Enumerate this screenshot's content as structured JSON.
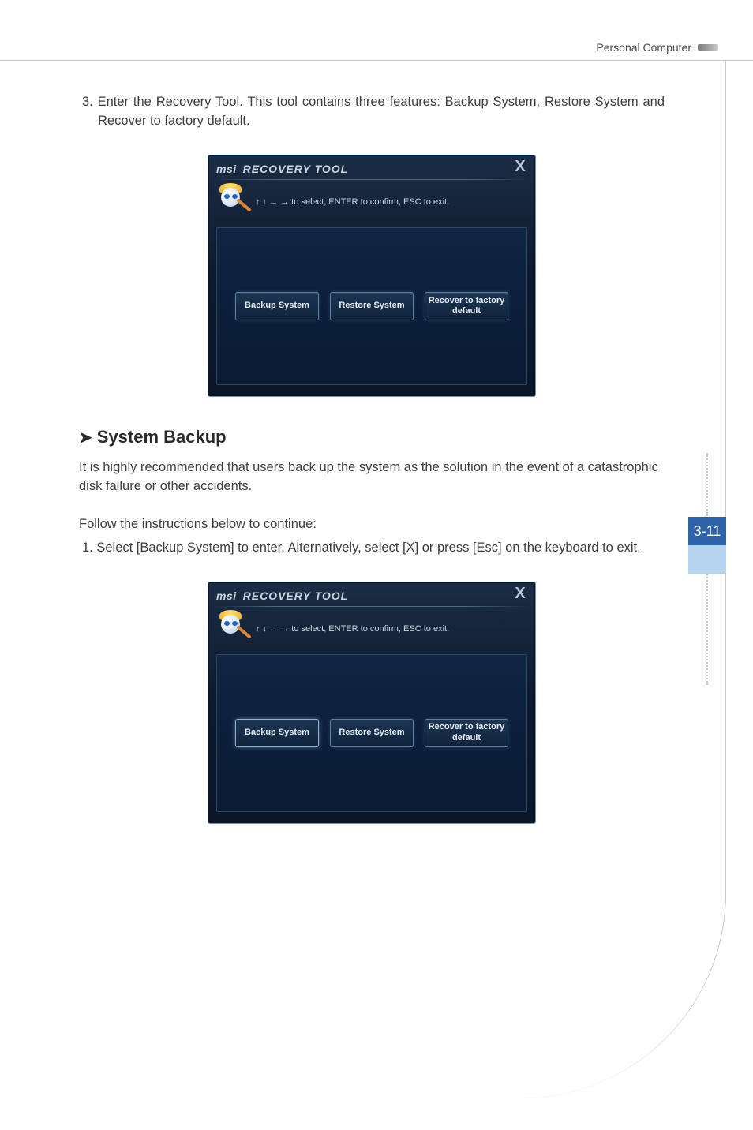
{
  "header": {
    "title": "Personal Computer",
    "page_number": "3-11"
  },
  "body": {
    "step3": "3. Enter the Recovery Tool. This tool contains three features: Backup System, Restore System and Recover to factory default.",
    "section_heading": "System Backup",
    "section_para": "It is highly recommended that users back up the system as the solution in the event of a catastrophic disk failure or other accidents.",
    "follow_para": "Follow the instructions below to continue:",
    "step1": "1. Select [Backup System] to enter. Alternatively, select [X] or press [Esc] on the keyboard to exit."
  },
  "recovery_tool": {
    "brand_prefix": "msi",
    "title": "RECOVERY TOOL",
    "instructions": "↑ ↓ ← → to select, ENTER to confirm, ESC to exit.",
    "close_label": "X",
    "buttons": {
      "backup": "Backup System",
      "restore": "Restore System",
      "recover": "Recover to factory default"
    }
  }
}
